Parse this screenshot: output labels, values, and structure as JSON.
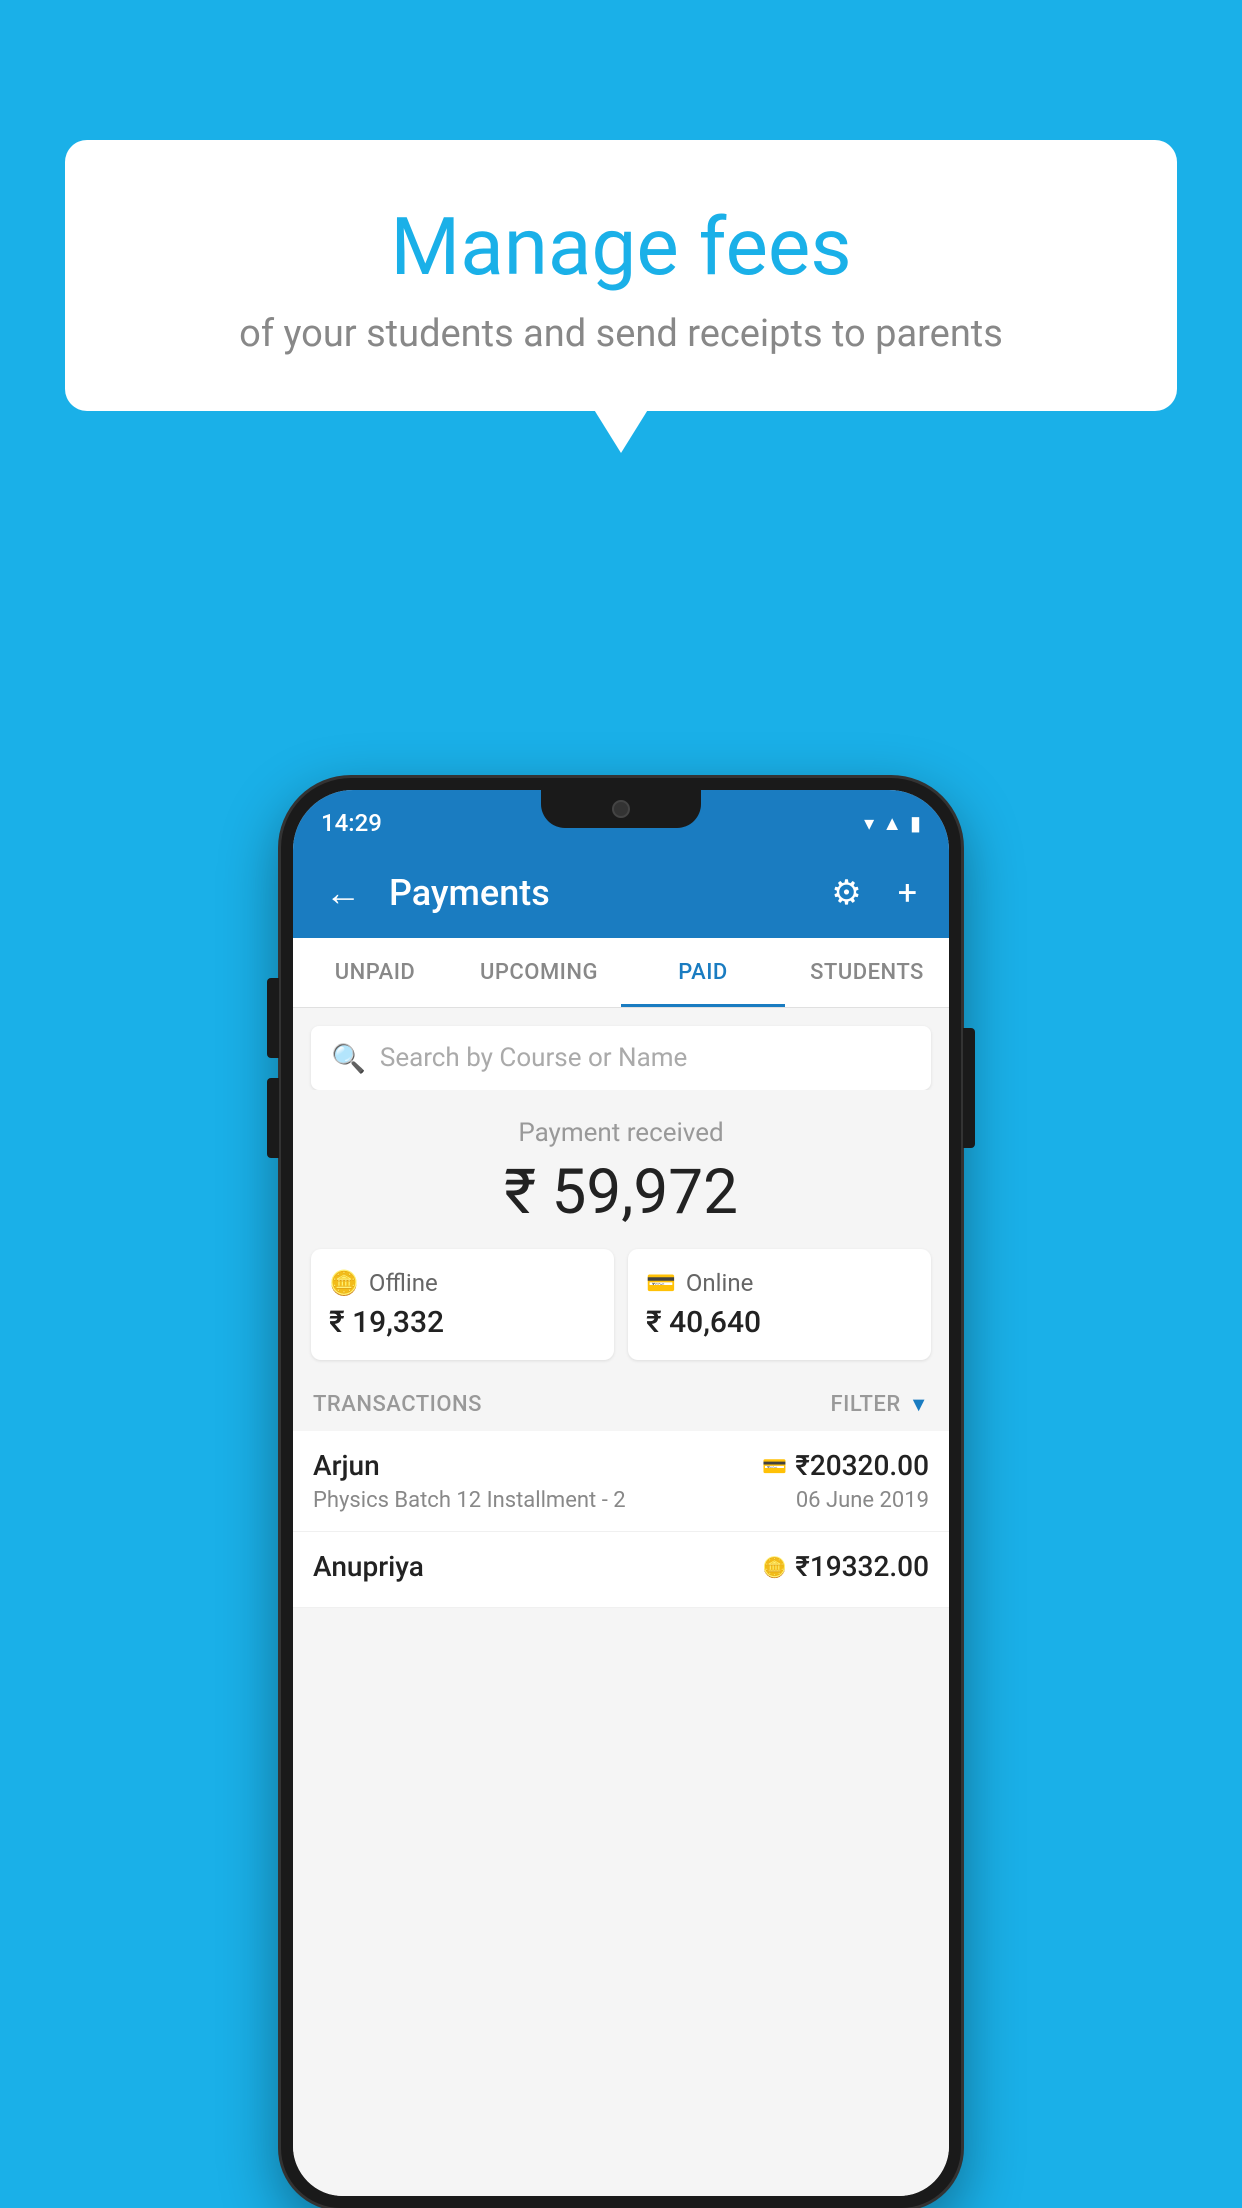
{
  "background_color": "#1ab0e8",
  "speech_bubble": {
    "title": "Manage fees",
    "subtitle": "of your students and send receipts to parents"
  },
  "phone": {
    "status_bar": {
      "time": "14:29"
    },
    "app_bar": {
      "title": "Payments",
      "back_label": "←",
      "gear_label": "⚙",
      "plus_label": "+"
    },
    "tabs": [
      {
        "label": "UNPAID",
        "active": false
      },
      {
        "label": "UPCOMING",
        "active": false
      },
      {
        "label": "PAID",
        "active": true
      },
      {
        "label": "STUDENTS",
        "active": false
      }
    ],
    "search": {
      "placeholder": "Search by Course or Name"
    },
    "payment_received": {
      "label": "Payment received",
      "amount": "₹ 59,972"
    },
    "offline_card": {
      "label": "Offline",
      "amount": "₹ 19,332",
      "icon": "💵"
    },
    "online_card": {
      "label": "Online",
      "amount": "₹ 40,640",
      "icon": "💳"
    },
    "transactions_header": {
      "label": "TRANSACTIONS",
      "filter_label": "FILTER"
    },
    "transactions": [
      {
        "name": "Arjun",
        "course": "Physics Batch 12 Installment - 2",
        "amount": "₹20320.00",
        "date": "06 June 2019",
        "type": "online"
      },
      {
        "name": "Anupriya",
        "course": "",
        "amount": "₹19332.00",
        "date": "",
        "type": "offline"
      }
    ]
  }
}
